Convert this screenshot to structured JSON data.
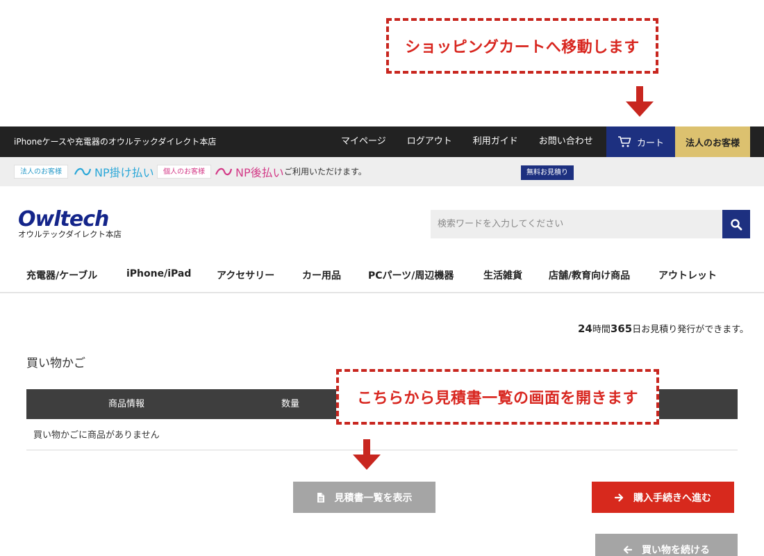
{
  "annotations": {
    "cart_callout": "ショッピングカートへ移動します",
    "quote_callout": "こちらから見積書一覧の画面を開きます"
  },
  "topbar": {
    "tagline": "iPhoneケースや充電器のオウルテックダイレクト本店",
    "nav": [
      "マイページ",
      "ログアウト",
      "利用ガイド",
      "お問い合わせ"
    ],
    "cart_label": "カート",
    "corporate_label": "法人のお客様"
  },
  "infobar": {
    "tag1": "法人のお客様",
    "np1": "NP掛け払い",
    "tag2": "個人のお客様",
    "np2": "NP後払い",
    "notice": "ご利用いただけます。",
    "estimate_badge": "無料お見積り",
    "estimate_hours": "24",
    "estimate_hours_unit": "時間",
    "estimate_days": "365",
    "estimate_rest": "日お見積り発行ができます。"
  },
  "header": {
    "logo_mark": "Owltech",
    "logo_sub": "オウルテックダイレクト本店",
    "search_placeholder": "検索ワードを入力してください"
  },
  "categories": [
    "充電器/ケーブル",
    "iPhone/iPad",
    "アクセサリー",
    "カー用品",
    "PCパーツ/周辺機器",
    "生活雑貨",
    "店舗/教育向け商品",
    "アウトレット"
  ],
  "cart": {
    "title": "買い物かご",
    "columns": [
      "商品情報",
      "数量"
    ],
    "empty_message": "買い物かごに商品がありません",
    "quote_button": "見積書一覧を表示",
    "checkout_button": "購入手続きへ進む",
    "continue_button": "買い物を続ける"
  },
  "colors": {
    "brand_navy": "#1d3080",
    "accent_red": "#d7291d",
    "corporate_gold": "#dcc16f"
  }
}
